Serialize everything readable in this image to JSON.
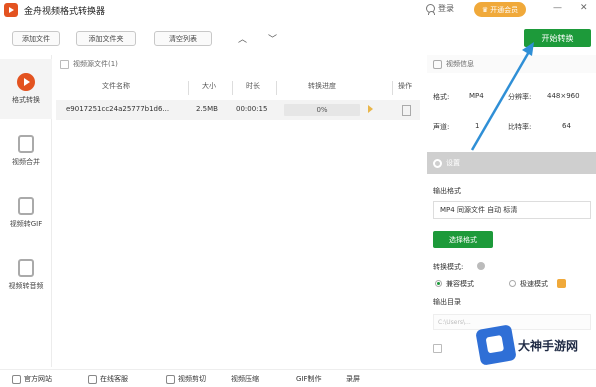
{
  "titlebar": {
    "title": "金舟视频格式转换器",
    "login_label": "登录",
    "vip_label": "开通会员",
    "minimize": "—",
    "close": "✕"
  },
  "toolbar": {
    "add_file": "添加文件",
    "add_folder": "添加文件夹",
    "clear_list": "清空列表",
    "sort_up": "︿",
    "sort_down": "﹀",
    "start_convert": "开始转换"
  },
  "nav": {
    "items": [
      {
        "label": "格式转换",
        "icon": "play-circle-icon"
      },
      {
        "label": "视频合并",
        "icon": "merge-icon"
      },
      {
        "label": "视频转GIF",
        "icon": "gif-icon"
      },
      {
        "label": "视频转音频",
        "icon": "audio-icon"
      }
    ]
  },
  "filelist": {
    "select_all": "视频源文件(1)",
    "columns": [
      "文件名称",
      "大小",
      "时长",
      "转换进度",
      "操作"
    ],
    "rows": [
      {
        "name": "e9017251cc24a25777b1d6...",
        "size": "2.5MB",
        "duration": "00:00:15",
        "progress": 0,
        "progress_text": "0%"
      }
    ]
  },
  "info": {
    "title": "视频信息",
    "format_label": "格式:",
    "format_value": "MP4",
    "resolution_label": "分辨率:",
    "resolution_value": "448×960",
    "channels_label": "声道:",
    "channels_value": "1",
    "bitrate_label": "比特率:",
    "bitrate_value": "64"
  },
  "settings": {
    "title": "设置",
    "output_format_label": "输出格式",
    "output_format_value": "MP4 同源文件 自动 标清",
    "select_format_button": "选择格式",
    "mode_label": "转换模式:",
    "mode_compat": "兼容模式",
    "mode_fast": "极速模式",
    "output_dir_label": "输出目录",
    "output_dir_value": "C:\\Users\\..."
  },
  "bottombar": {
    "items": [
      "官方网站",
      "在线客服",
      "视频剪切",
      "视频压缩",
      "GIF制作",
      "录屏"
    ]
  },
  "watermark": {
    "text": "大神手游网"
  },
  "colors": {
    "accent_green": "#1d9a3a",
    "brand_orange": "#e35320",
    "vip_gold": "#f0a93a"
  }
}
